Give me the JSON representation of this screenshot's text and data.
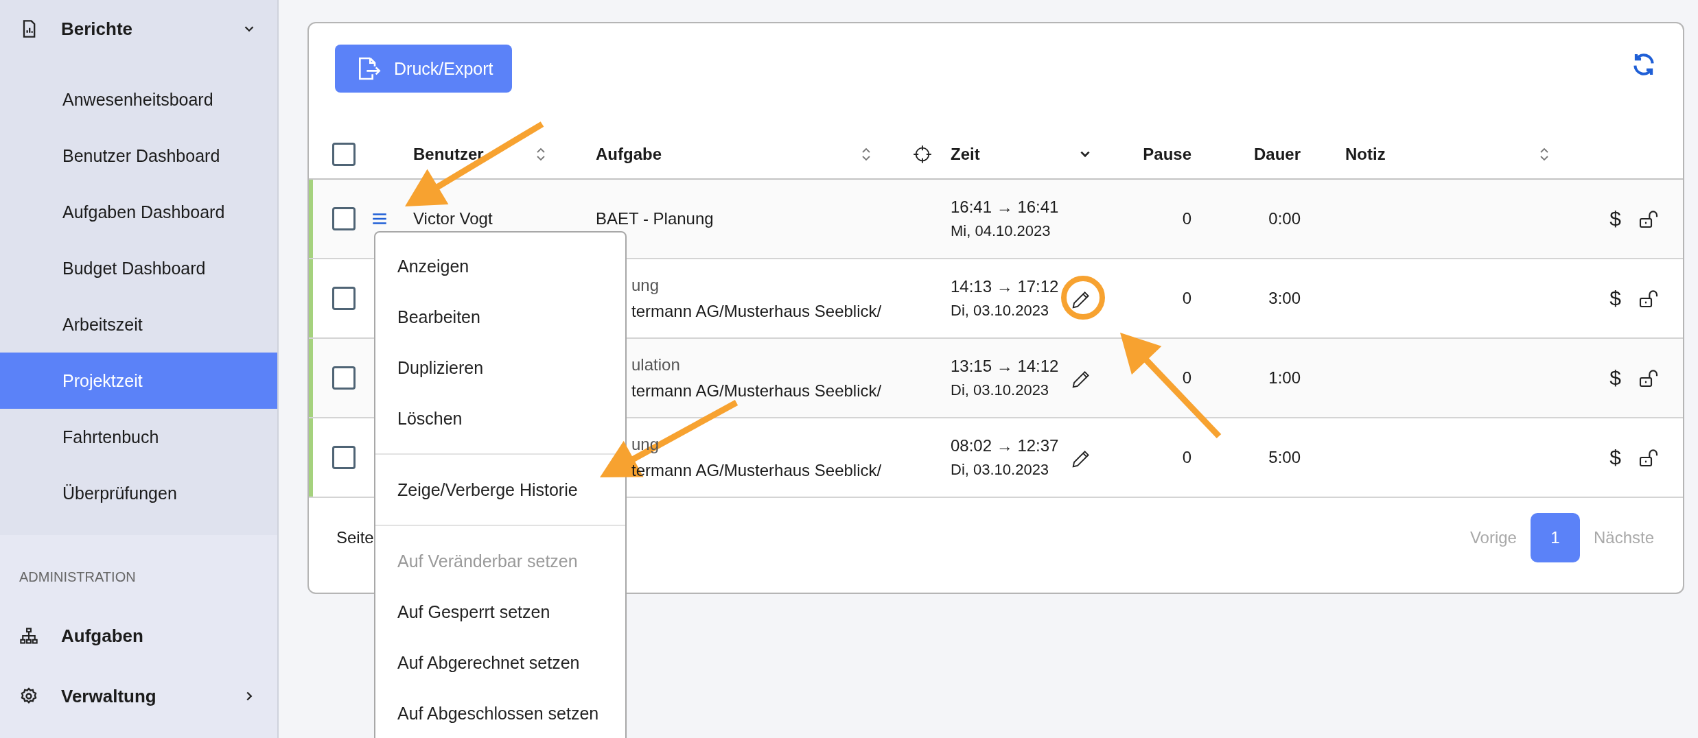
{
  "sidebar": {
    "reports": {
      "label": "Berichte",
      "expanded": true,
      "items": [
        {
          "label": "Anwesenheitsboard",
          "selected": false
        },
        {
          "label": "Benutzer Dashboard",
          "selected": false
        },
        {
          "label": "Aufgaben Dashboard",
          "selected": false
        },
        {
          "label": "Budget Dashboard",
          "selected": false
        },
        {
          "label": "Arbeitszeit",
          "selected": false
        },
        {
          "label": "Projektzeit",
          "selected": true
        },
        {
          "label": "Fahrtenbuch",
          "selected": false
        },
        {
          "label": "Überprüfungen",
          "selected": false
        }
      ]
    },
    "section_title": "ADMINISTRATION",
    "admin_items": [
      {
        "label": "Aufgaben",
        "kind": "link"
      },
      {
        "label": "Verwaltung",
        "kind": "submenu"
      }
    ]
  },
  "toolbar": {
    "export_button": "Druck/Export"
  },
  "table": {
    "all_checked": false,
    "columns": [
      {
        "label": "Benutzer",
        "sortable": true,
        "sorted": false
      },
      {
        "label": "Aufgabe",
        "sortable": true,
        "sorted": false
      },
      {
        "label": "Zeit",
        "sortable": true,
        "sorted": true
      },
      {
        "label": "Pause"
      },
      {
        "label": "Dauer"
      },
      {
        "label": "Notiz",
        "sortable": true,
        "sorted": false
      }
    ],
    "rows": [
      {
        "checked": false,
        "menu_open": true,
        "user": "Victor Vogt",
        "task": [
          "BAET - Planung"
        ],
        "task_covered": false,
        "time": "16:41 → 16:41",
        "date": "Mi, 04.10.2023",
        "editable": false,
        "pause": "0",
        "duration": "0:00",
        "billing": "$",
        "locked": false
      },
      {
        "checked": false,
        "menu_open": false,
        "task": [
          "ung",
          "termann AG/Musterhaus Seeblick/"
        ],
        "task_covered": true,
        "time": "14:13 → 17:12",
        "date": "Di, 03.10.2023",
        "editable": true,
        "pause": "0",
        "duration": "3:00",
        "billing": "$",
        "locked": false
      },
      {
        "checked": false,
        "menu_open": false,
        "task": [
          "ulation",
          "termann AG/Musterhaus Seeblick/"
        ],
        "task_covered": true,
        "time": "13:15 → 14:12",
        "date": "Di, 03.10.2023",
        "editable": true,
        "pause": "0",
        "duration": "1:00",
        "billing": "$",
        "locked": false
      },
      {
        "checked": false,
        "menu_open": false,
        "task": [
          "ung",
          "termann AG/Musterhaus Seeblick/"
        ],
        "task_covered": true,
        "time": "08:02 → 12:37",
        "date": "Di, 03.10.2023",
        "editable": true,
        "pause": "0",
        "duration": "5:00",
        "billing": "$",
        "locked": false
      }
    ]
  },
  "pagination": {
    "page_label": "Seite",
    "previous": "Vorige",
    "next": "Nächste",
    "previous_disabled": true,
    "next_disabled": true,
    "pages": [
      {
        "label": "1",
        "selected": true
      }
    ]
  },
  "context_menu": {
    "groups": [
      [
        {
          "label": "Anzeigen",
          "disabled": false
        },
        {
          "label": "Bearbeiten",
          "disabled": false
        },
        {
          "label": "Duplizieren",
          "disabled": false
        },
        {
          "label": "Löschen",
          "disabled": false
        }
      ],
      [
        {
          "label": "Zeige/Verberge Historie",
          "disabled": false
        }
      ],
      [
        {
          "label": "Auf Veränderbar setzen",
          "disabled": true
        },
        {
          "label": "Auf Gesperrt setzen",
          "disabled": false
        },
        {
          "label": "Auf Abgerechnet setzen",
          "disabled": false
        },
        {
          "label": "Auf Abgeschlossen setzen",
          "disabled": false
        }
      ]
    ]
  },
  "annotations": [
    {
      "kind": "arrow"
    },
    {
      "kind": "circle"
    },
    {
      "kind": "arrow"
    },
    {
      "kind": "arrow"
    }
  ]
}
